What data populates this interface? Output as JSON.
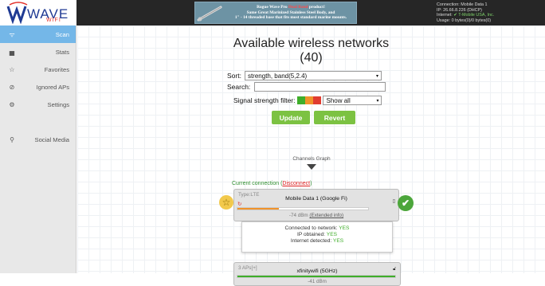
{
  "header": {
    "logo_text": "WAVE",
    "logo_sub": "WIFI",
    "ad": {
      "line1_a": "Rogue Wave Pro ",
      "line1_dual": "Dual Band",
      "line1_b": " product!",
      "line2": "Same Great Marinized Stainless Steel Body, and",
      "line3": "1\" - 14 threaded base that fits most standard marine mounts."
    },
    "connection": {
      "line1": "Connection: Mobile Data 1",
      "line2": "IP: 26.66.8.226 (DHCP)",
      "line3_label": "Internet: ",
      "line3_value": "✔ T-Mobile USA, Inc.",
      "line4": "Usage: 0 bytes(0)/0 bytes(0)"
    }
  },
  "sidebar": {
    "items": [
      {
        "label": "Scan",
        "icon": "wifi-icon",
        "glyph": "ᯤ"
      },
      {
        "label": "Stats",
        "icon": "chart-icon",
        "glyph": "▅"
      },
      {
        "label": "Favorites",
        "icon": "star-icon",
        "glyph": "☆"
      },
      {
        "label": "Ignored APs",
        "icon": "ban-icon",
        "glyph": "⊘"
      },
      {
        "label": "Settings",
        "icon": "gears-icon",
        "glyph": "⚙"
      },
      {
        "label": "Social Media",
        "icon": "share-icon",
        "glyph": "⚲"
      }
    ]
  },
  "main": {
    "title_line1": "Available wireless networks",
    "title_line2": "(40)",
    "sort_label": "Sort:",
    "sort_value": "strength, band(5,2.4)",
    "search_label": "Search:",
    "search_value": "",
    "filter_label": "Signal strength filter:",
    "filter_value": "Show all",
    "update_label": "Update",
    "revert_label": "Revert",
    "channels_label": "Channels Graph",
    "current_label": "Current connection (",
    "disconnect_label": "Disconnect",
    "current_close": ")",
    "current_card": {
      "type": "Type:LTE",
      "name": "Mobile Data 1 (Google Fi)",
      "dbm": "-74 dBm ",
      "extended": "(Extended info)",
      "signal_fraction": 0.32,
      "bar_color": "#f0932b"
    },
    "info": {
      "connected_label": "Connected to network: ",
      "connected_value": "YES",
      "ip_label": "IP obtained: ",
      "ip_value": "YES",
      "internet_label": "Internet detected: ",
      "internet_value": "YES"
    },
    "second_card": {
      "type": "3 APs[+]",
      "name": "xfinitywifi (5GHz)",
      "dbm": "-41 dBm",
      "signal_fraction": 1.0,
      "bar_color": "#3fae2a"
    }
  },
  "colors": {
    "accent_blue": "#74b7e8",
    "button_green": "#7cc242",
    "connected_green": "#2f8f2f",
    "disconnect_red": "#dd2222"
  }
}
